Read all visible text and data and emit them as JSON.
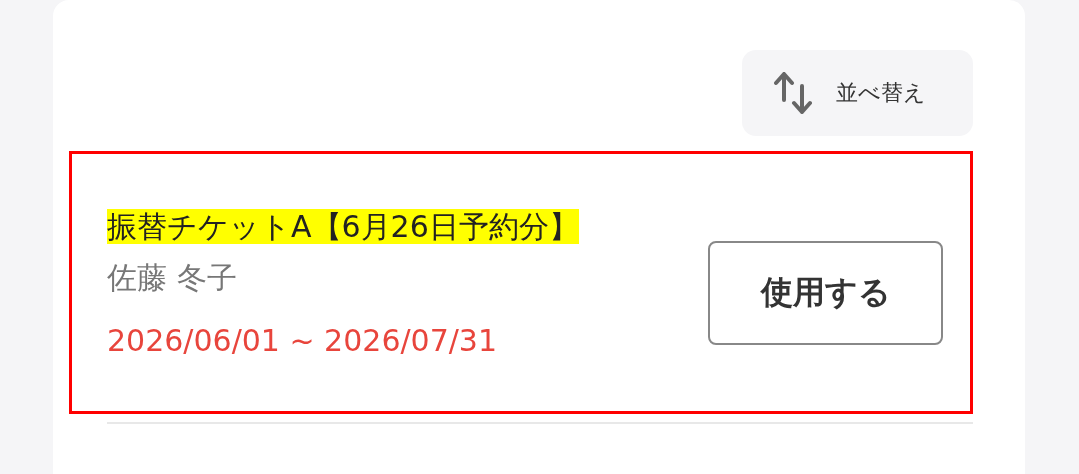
{
  "sort_button": {
    "label": "並べ替え"
  },
  "tickets": [
    {
      "title": "振替チケットA【6月26日予約分】",
      "holder": "佐藤 冬子",
      "period": "2026/06/01 ~ 2026/07/31",
      "highlighted": true,
      "action": "使用する"
    }
  ]
}
